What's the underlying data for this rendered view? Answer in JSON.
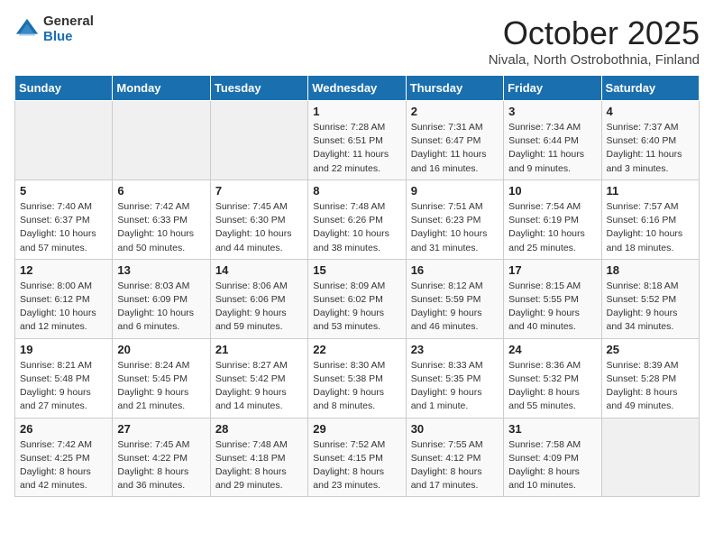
{
  "logo": {
    "general": "General",
    "blue": "Blue"
  },
  "title": "October 2025",
  "location": "Nivala, North Ostrobothnia, Finland",
  "days_header": [
    "Sunday",
    "Monday",
    "Tuesday",
    "Wednesday",
    "Thursday",
    "Friday",
    "Saturday"
  ],
  "weeks": [
    [
      {
        "day": "",
        "info": ""
      },
      {
        "day": "",
        "info": ""
      },
      {
        "day": "",
        "info": ""
      },
      {
        "day": "1",
        "info": "Sunrise: 7:28 AM\nSunset: 6:51 PM\nDaylight: 11 hours\nand 22 minutes."
      },
      {
        "day": "2",
        "info": "Sunrise: 7:31 AM\nSunset: 6:47 PM\nDaylight: 11 hours\nand 16 minutes."
      },
      {
        "day": "3",
        "info": "Sunrise: 7:34 AM\nSunset: 6:44 PM\nDaylight: 11 hours\nand 9 minutes."
      },
      {
        "day": "4",
        "info": "Sunrise: 7:37 AM\nSunset: 6:40 PM\nDaylight: 11 hours\nand 3 minutes."
      }
    ],
    [
      {
        "day": "5",
        "info": "Sunrise: 7:40 AM\nSunset: 6:37 PM\nDaylight: 10 hours\nand 57 minutes."
      },
      {
        "day": "6",
        "info": "Sunrise: 7:42 AM\nSunset: 6:33 PM\nDaylight: 10 hours\nand 50 minutes."
      },
      {
        "day": "7",
        "info": "Sunrise: 7:45 AM\nSunset: 6:30 PM\nDaylight: 10 hours\nand 44 minutes."
      },
      {
        "day": "8",
        "info": "Sunrise: 7:48 AM\nSunset: 6:26 PM\nDaylight: 10 hours\nand 38 minutes."
      },
      {
        "day": "9",
        "info": "Sunrise: 7:51 AM\nSunset: 6:23 PM\nDaylight: 10 hours\nand 31 minutes."
      },
      {
        "day": "10",
        "info": "Sunrise: 7:54 AM\nSunset: 6:19 PM\nDaylight: 10 hours\nand 25 minutes."
      },
      {
        "day": "11",
        "info": "Sunrise: 7:57 AM\nSunset: 6:16 PM\nDaylight: 10 hours\nand 18 minutes."
      }
    ],
    [
      {
        "day": "12",
        "info": "Sunrise: 8:00 AM\nSunset: 6:12 PM\nDaylight: 10 hours\nand 12 minutes."
      },
      {
        "day": "13",
        "info": "Sunrise: 8:03 AM\nSunset: 6:09 PM\nDaylight: 10 hours\nand 6 minutes."
      },
      {
        "day": "14",
        "info": "Sunrise: 8:06 AM\nSunset: 6:06 PM\nDaylight: 9 hours\nand 59 minutes."
      },
      {
        "day": "15",
        "info": "Sunrise: 8:09 AM\nSunset: 6:02 PM\nDaylight: 9 hours\nand 53 minutes."
      },
      {
        "day": "16",
        "info": "Sunrise: 8:12 AM\nSunset: 5:59 PM\nDaylight: 9 hours\nand 46 minutes."
      },
      {
        "day": "17",
        "info": "Sunrise: 8:15 AM\nSunset: 5:55 PM\nDaylight: 9 hours\nand 40 minutes."
      },
      {
        "day": "18",
        "info": "Sunrise: 8:18 AM\nSunset: 5:52 PM\nDaylight: 9 hours\nand 34 minutes."
      }
    ],
    [
      {
        "day": "19",
        "info": "Sunrise: 8:21 AM\nSunset: 5:48 PM\nDaylight: 9 hours\nand 27 minutes."
      },
      {
        "day": "20",
        "info": "Sunrise: 8:24 AM\nSunset: 5:45 PM\nDaylight: 9 hours\nand 21 minutes."
      },
      {
        "day": "21",
        "info": "Sunrise: 8:27 AM\nSunset: 5:42 PM\nDaylight: 9 hours\nand 14 minutes."
      },
      {
        "day": "22",
        "info": "Sunrise: 8:30 AM\nSunset: 5:38 PM\nDaylight: 9 hours\nand 8 minutes."
      },
      {
        "day": "23",
        "info": "Sunrise: 8:33 AM\nSunset: 5:35 PM\nDaylight: 9 hours\nand 1 minute."
      },
      {
        "day": "24",
        "info": "Sunrise: 8:36 AM\nSunset: 5:32 PM\nDaylight: 8 hours\nand 55 minutes."
      },
      {
        "day": "25",
        "info": "Sunrise: 8:39 AM\nSunset: 5:28 PM\nDaylight: 8 hours\nand 49 minutes."
      }
    ],
    [
      {
        "day": "26",
        "info": "Sunrise: 7:42 AM\nSunset: 4:25 PM\nDaylight: 8 hours\nand 42 minutes."
      },
      {
        "day": "27",
        "info": "Sunrise: 7:45 AM\nSunset: 4:22 PM\nDaylight: 8 hours\nand 36 minutes."
      },
      {
        "day": "28",
        "info": "Sunrise: 7:48 AM\nSunset: 4:18 PM\nDaylight: 8 hours\nand 29 minutes."
      },
      {
        "day": "29",
        "info": "Sunrise: 7:52 AM\nSunset: 4:15 PM\nDaylight: 8 hours\nand 23 minutes."
      },
      {
        "day": "30",
        "info": "Sunrise: 7:55 AM\nSunset: 4:12 PM\nDaylight: 8 hours\nand 17 minutes."
      },
      {
        "day": "31",
        "info": "Sunrise: 7:58 AM\nSunset: 4:09 PM\nDaylight: 8 hours\nand 10 minutes."
      },
      {
        "day": "",
        "info": ""
      }
    ]
  ]
}
